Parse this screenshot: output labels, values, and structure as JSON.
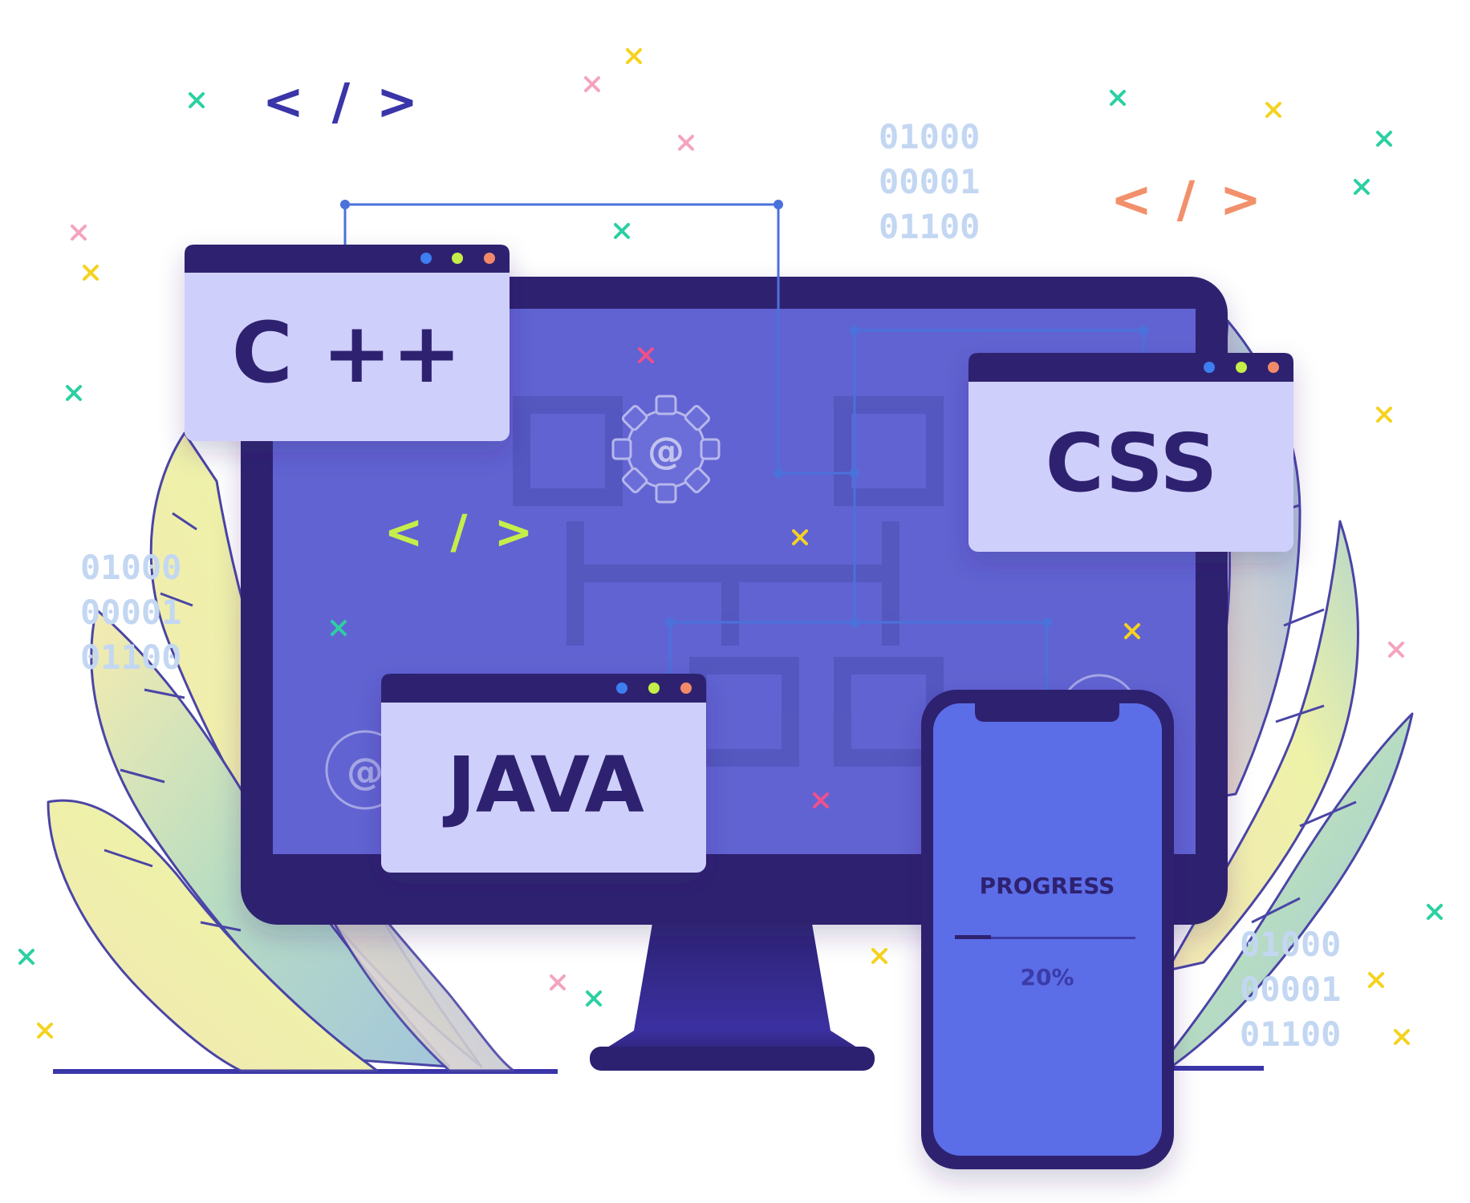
{
  "binary_rows": [
    "01000",
    "00001",
    "01100"
  ],
  "code_tag": [
    "<",
    "/",
    ">"
  ],
  "windows": {
    "cpp": {
      "label": "C ++"
    },
    "css": {
      "label": "CSS"
    },
    "java": {
      "label": "JAVA"
    }
  },
  "gear_symbol": "@",
  "phone": {
    "title": "PROGRESS",
    "value_text": "20%",
    "progress": 0.2
  },
  "colors": {
    "bezel": "#2e2270",
    "screen": "#6163d2",
    "window_body": "#cfcffb",
    "phone_screen": "#5b6de8",
    "connector": "#4a72da",
    "dot_blue": "#3d7ef0",
    "dot_green": "#c6ee4a",
    "dot_orange": "#f28a6a"
  }
}
